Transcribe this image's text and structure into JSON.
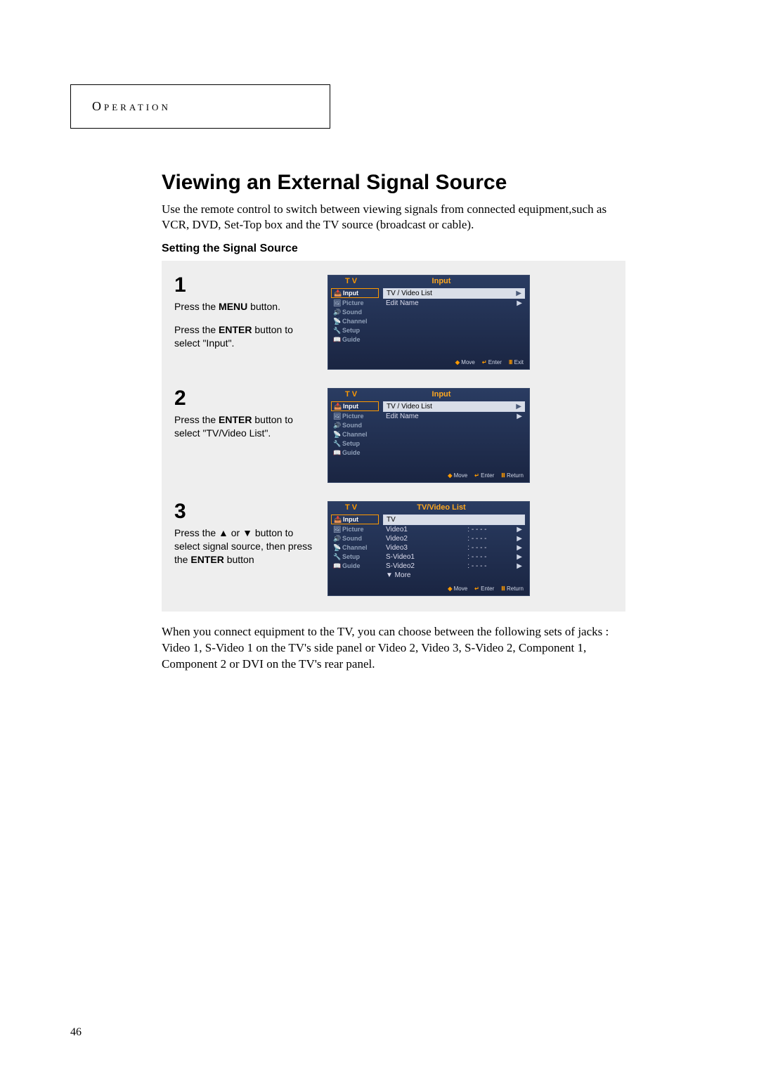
{
  "section_header": "Operation",
  "title": "Viewing an External Signal Source",
  "intro": "Use the remote control to switch between viewing signals from connected equipment,such as VCR, DVD, Set-Top box and the TV source (broadcast or cable).",
  "subheading": "Setting the Signal Source",
  "steps": {
    "s1": {
      "num": "1",
      "line1a": "Press the ",
      "line1b": "MENU",
      "line1c": " button.",
      "line2a": "Press the ",
      "line2b": "ENTER",
      "line2c": " button to select \"Input\"."
    },
    "s2": {
      "num": "2",
      "line1a": "Press the ",
      "line1b": "ENTER",
      "line1c": " button to select \"TV/Video List\"."
    },
    "s3": {
      "num": "3",
      "line1a": "Press the ▲ or ▼ button to select signal source, then press the ",
      "line1b": "ENTER",
      "line1c": " button"
    }
  },
  "osd": {
    "tv_label": "T V",
    "side": {
      "input": "Input",
      "picture": "Picture",
      "sound": "Sound",
      "channel": "Channel",
      "setup": "Setup",
      "guide": "Guide"
    },
    "panel1": {
      "title": "Input",
      "rows": [
        "TV / Video List",
        "Edit Name"
      ],
      "footer_move": "Move",
      "footer_enter": "Enter",
      "footer_exit": "Exit"
    },
    "panel2": {
      "title": "Input",
      "rows": [
        "TV / Video List",
        "Edit Name"
      ],
      "footer_move": "Move",
      "footer_enter": "Enter",
      "footer_return": "Return"
    },
    "panel3": {
      "title": "TV/Video List",
      "rows": [
        {
          "lbl": "TV",
          "val": ""
        },
        {
          "lbl": "Video1",
          "val": ": - - - -"
        },
        {
          "lbl": "Video2",
          "val": ": - - - -"
        },
        {
          "lbl": "Video3",
          "val": ": - - - -"
        },
        {
          "lbl": "S-Video1",
          "val": ": - - - -"
        },
        {
          "lbl": "S-Video2",
          "val": ": - - - -"
        },
        {
          "lbl": "▼ More",
          "val": ""
        }
      ],
      "footer_move": "Move",
      "footer_enter": "Enter",
      "footer_return": "Return"
    }
  },
  "after": "When you connect equipment to the TV, you can choose between the following sets of jacks : Video 1, S-Video 1 on the TV's side panel or Video 2, Video 3, S-Video 2, Component 1, Component 2 or DVI on the TV's rear panel.",
  "page_number": "46"
}
